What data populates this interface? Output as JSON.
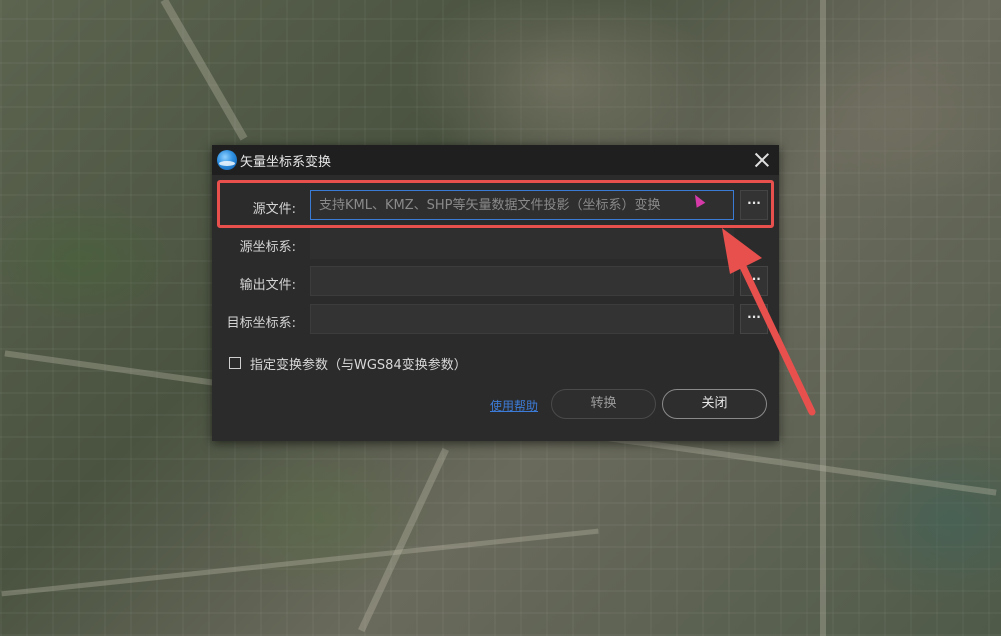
{
  "window": {
    "title": "矢量坐标系变换"
  },
  "form": {
    "source_file": {
      "label": "源文件:",
      "placeholder": "支持KML、KMZ、SHP等矢量数据文件投影（坐标系）变换",
      "value": ""
    },
    "source_crs": {
      "label": "源坐标系:",
      "value": ""
    },
    "output_file": {
      "label": "输出文件:",
      "value": ""
    },
    "target_crs": {
      "label": "目标坐标系:",
      "value": ""
    },
    "browse_label": "···",
    "custom_params": {
      "label": "指定变换参数（与WGS84变换参数）",
      "checked": false
    }
  },
  "footer": {
    "help_link": "使用帮助",
    "convert_label": "转换",
    "close_label": "关闭"
  },
  "colors": {
    "highlight": "#e8504d",
    "arrow": "#e8504d",
    "link": "#3c7bd8",
    "dialog_bg": "#2b2b2b"
  },
  "icons": {
    "app": "globe-icon",
    "close": "close-icon",
    "browse": "ellipsis-icon"
  }
}
